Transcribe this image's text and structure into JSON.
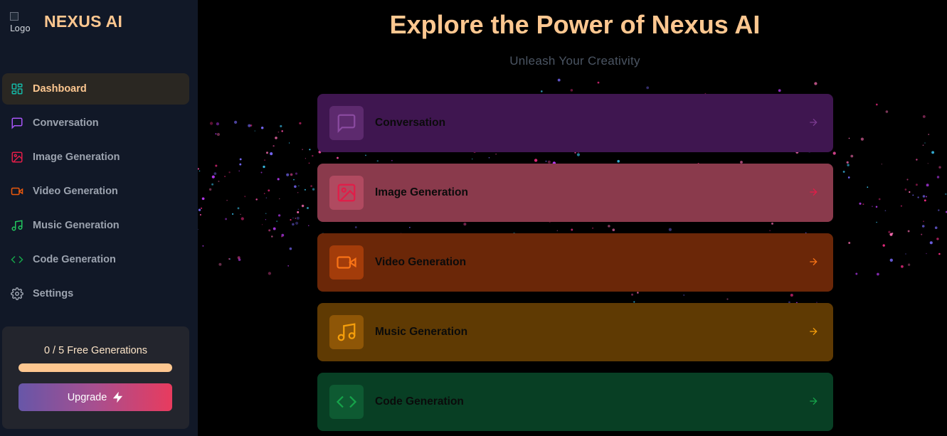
{
  "brand": {
    "logo_alt": "Logo",
    "name": "NEXUS AI"
  },
  "nav": [
    {
      "label": "Dashboard",
      "icon": "dashboard-icon",
      "active": true,
      "color": "#14b8a6"
    },
    {
      "label": "Conversation",
      "icon": "chat-icon",
      "color": "#a855f7"
    },
    {
      "label": "Image Generation",
      "icon": "image-icon",
      "color": "#e11d48"
    },
    {
      "label": "Video Generation",
      "icon": "video-icon",
      "color": "#ea580c"
    },
    {
      "label": "Music Generation",
      "icon": "music-icon",
      "color": "#22c55e"
    },
    {
      "label": "Code Generation",
      "icon": "code-icon",
      "color": "#16a34a"
    },
    {
      "label": "Settings",
      "icon": "gear-icon",
      "color": "#9ca3af"
    }
  ],
  "limit": {
    "text": "0 / 5 Free Generations",
    "used": 0,
    "total": 5,
    "upgrade_label": "Upgrade"
  },
  "main": {
    "headline": "Explore the Power of Nexus AI",
    "subheadline": "Unleash Your Creativity"
  },
  "tools": [
    {
      "label": "Conversation",
      "icon": "chat-icon",
      "bg": "#3f1650",
      "tile": "#5d2a6e",
      "accent": "#a855f7"
    },
    {
      "label": "Image Generation",
      "icon": "image-icon",
      "bg": "#8a3a4c",
      "tile": "#b04a60",
      "accent": "#e11d48"
    },
    {
      "label": "Video Generation",
      "icon": "video-icon",
      "bg": "#6b2708",
      "tile": "#a33c0a",
      "accent": "#f97316"
    },
    {
      "label": "Music Generation",
      "icon": "music-icon",
      "bg": "#5f3a03",
      "tile": "#8e5607",
      "accent": "#f59e0b"
    },
    {
      "label": "Code Generation",
      "icon": "code-icon",
      "bg": "#083f24",
      "tile": "#0e5a32",
      "accent": "#16a34a"
    }
  ]
}
